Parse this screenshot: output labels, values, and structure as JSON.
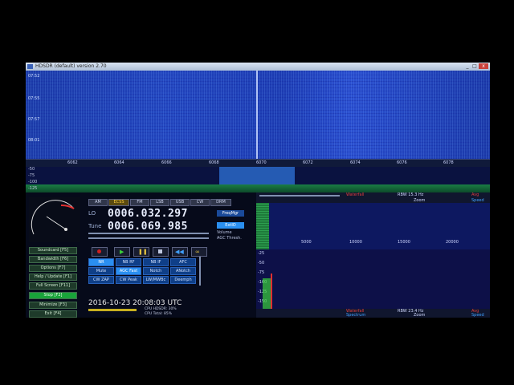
{
  "window": {
    "title": "HDSDR (default) version 2.70"
  },
  "waterfall": {
    "times": [
      "07:52",
      "07:55",
      "07:57",
      "08:01"
    ],
    "freq_ticks": [
      "6062",
      "6064",
      "6066",
      "6068",
      "6070",
      "6072",
      "6074",
      "6076",
      "6078"
    ]
  },
  "spectrum": {
    "levels": [
      "-50",
      "-75",
      "-100",
      "-125"
    ]
  },
  "modes": [
    "AM",
    "ECSS",
    "FM",
    "LSB",
    "USB",
    "CW",
    "DRM"
  ],
  "lo": {
    "label": "LO",
    "value": "0006.032.297"
  },
  "tune": {
    "label": "Tune",
    "value": "0006.069.985"
  },
  "freq_mgr": "FreqMgr",
  "extio": "ExtIO",
  "volume": {
    "label1": "Volume",
    "label2": "AGC Thresh."
  },
  "side_buttons": [
    {
      "label": "Soundcard",
      "key": "[F5]",
      "active": false
    },
    {
      "label": "Bandwidth",
      "key": "[F6]",
      "active": false
    },
    {
      "label": "Options",
      "key": "[F7]",
      "active": false
    },
    {
      "label": "Help / Update",
      "key": "[F1]",
      "active": false
    },
    {
      "label": "Full Screen",
      "key": "[F11]",
      "active": false
    },
    {
      "label": "Stop",
      "key": "[F2]",
      "active": true
    },
    {
      "label": "Minimize",
      "key": "[F3]",
      "active": false
    },
    {
      "label": "Exit",
      "key": "[F4]",
      "active": false
    }
  ],
  "dsp": [
    [
      "NR",
      "NB RF",
      "NB IF",
      "AFC"
    ],
    [
      "Mute",
      "AGC Fast",
      "Notch",
      "ANotch"
    ],
    [
      "CW ZAP",
      "CW Peak",
      "LW/MWBc",
      "Deemph"
    ]
  ],
  "datetime": "2016-10-23   20:08:03 UTC",
  "cpu": {
    "line1": "CPU HDSDR: 30%",
    "line2": "CPU Total: 85%"
  },
  "right": {
    "waterfall_label": "Waterfall",
    "spectrum_label": "Spectrum",
    "rbw_top": "RBW 15.3 Hz",
    "rbw_bottom": "RBW 23.4 Hz",
    "zoom": "Zoom",
    "avg": "Avg",
    "speed": "Speed",
    "audio_ticks": [
      "5000",
      "10000",
      "15000",
      "20000"
    ],
    "levels": [
      "-25",
      "-50",
      "-75",
      "-100",
      "-125",
      "-150"
    ]
  },
  "colors": {
    "accent_green": "#19a33a",
    "waterfall_blue": "#2347c0",
    "dsp_blue": "#2a8ff0"
  }
}
